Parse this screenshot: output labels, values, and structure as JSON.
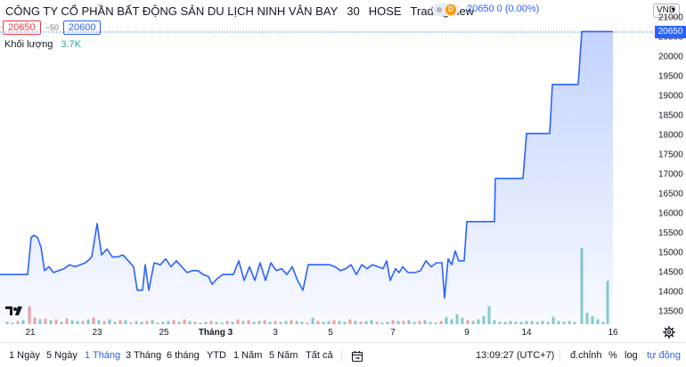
{
  "header": {
    "symbol_name": "CÔNG TY CỔ PHẦN BẤT ĐỘNG SẢN DU LỊCH NINH VÂN BAY",
    "interval": "30",
    "exchange": "HOSE",
    "provider": "TradingView",
    "status_badge": "D",
    "last_price": "20650",
    "change": "0 (0.00%)"
  },
  "quote": {
    "bid": "20650",
    "spread": "−50",
    "ask": "20600"
  },
  "volume": {
    "label": "Khối lượng",
    "value": "3.7K"
  },
  "currency": "VND",
  "price_scale": {
    "ticks": [
      "21000",
      "20500",
      "20000",
      "19500",
      "19000",
      "18500",
      "18000",
      "17500",
      "17000",
      "16500",
      "16000",
      "15500",
      "15000",
      "14500",
      "14000",
      "13500"
    ],
    "current_tag": "20650"
  },
  "time_axis": {
    "ticks": [
      "21",
      "23",
      "25",
      "Tháng 3",
      "3",
      "5",
      "7",
      "9",
      "14",
      "16",
      "21"
    ]
  },
  "bottom_bar": {
    "ranges": [
      "1 Ngày",
      "5 Ngày",
      "1 Tháng",
      "3 Tháng",
      "6 tháng",
      "YTD",
      "1 Năm",
      "5 Năm",
      "Tất cả"
    ],
    "active_range": "1 Tháng",
    "time": "13:09:27 (UTC+7)",
    "adjust": "đ.chỉnh",
    "percent": "%",
    "log": "log",
    "auto": "tự động"
  },
  "colors": {
    "line": "#2962ff",
    "area_top": "rgba(41,98,255,0.28)",
    "up_volume": "#26a69a",
    "down_volume": "#ef5350",
    "accent": "#2962ff"
  },
  "chart_data": {
    "type": "area",
    "ylim": [
      13200,
      21150
    ],
    "price_points": [
      [
        0,
        14450
      ],
      [
        16,
        14450
      ],
      [
        31,
        14450
      ],
      [
        35,
        15400
      ],
      [
        38,
        15450
      ],
      [
        42,
        15400
      ],
      [
        46,
        15150
      ],
      [
        50,
        14550
      ],
      [
        55,
        14650
      ],
      [
        60,
        14500
      ],
      [
        66,
        14550
      ],
      [
        72,
        14600
      ],
      [
        78,
        14700
      ],
      [
        84,
        14650
      ],
      [
        90,
        14700
      ],
      [
        96,
        14750
      ],
      [
        103,
        14900
      ],
      [
        109,
        15750
      ],
      [
        114,
        14950
      ],
      [
        120,
        15100
      ],
      [
        126,
        14900
      ],
      [
        132,
        14900
      ],
      [
        138,
        14950
      ],
      [
        144,
        14800
      ],
      [
        150,
        14650
      ],
      [
        154,
        14050
      ],
      [
        160,
        14050
      ],
      [
        163,
        14700
      ],
      [
        167,
        14050
      ],
      [
        173,
        14750
      ],
      [
        180,
        14700
      ],
      [
        186,
        14850
      ],
      [
        192,
        14650
      ],
      [
        198,
        14800
      ],
      [
        204,
        14650
      ],
      [
        210,
        14500
      ],
      [
        216,
        14550
      ],
      [
        222,
        14550
      ],
      [
        228,
        14450
      ],
      [
        234,
        14400
      ],
      [
        238,
        14200
      ],
      [
        244,
        14350
      ],
      [
        250,
        14450
      ],
      [
        256,
        14450
      ],
      [
        262,
        14450
      ],
      [
        268,
        14800
      ],
      [
        274,
        14300
      ],
      [
        280,
        14650
      ],
      [
        286,
        14300
      ],
      [
        292,
        14750
      ],
      [
        298,
        14300
      ],
      [
        304,
        14750
      ],
      [
        310,
        14550
      ],
      [
        316,
        14600
      ],
      [
        322,
        14450
      ],
      [
        328,
        14650
      ],
      [
        334,
        14300
      ],
      [
        340,
        14050
      ],
      [
        346,
        14700
      ],
      [
        352,
        14700
      ],
      [
        358,
        14700
      ],
      [
        364,
        14700
      ],
      [
        370,
        14700
      ],
      [
        376,
        14650
      ],
      [
        382,
        14550
      ],
      [
        388,
        14600
      ],
      [
        394,
        14700
      ],
      [
        400,
        14450
      ],
      [
        406,
        14700
      ],
      [
        412,
        14600
      ],
      [
        418,
        14700
      ],
      [
        424,
        14650
      ],
      [
        430,
        14600
      ],
      [
        434,
        14800
      ],
      [
        438,
        14300
      ],
      [
        444,
        14600
      ],
      [
        448,
        14500
      ],
      [
        452,
        14650
      ],
      [
        458,
        14500
      ],
      [
        466,
        14500
      ],
      [
        472,
        14550
      ],
      [
        478,
        14800
      ],
      [
        484,
        14650
      ],
      [
        490,
        14750
      ],
      [
        496,
        14750
      ],
      [
        499,
        13850
      ],
      [
        503,
        14850
      ],
      [
        507,
        14700
      ],
      [
        511,
        15050
      ],
      [
        515,
        14800
      ],
      [
        521,
        14800
      ],
      [
        524,
        15800
      ],
      [
        555,
        15800
      ],
      [
        556,
        16900
      ],
      [
        587,
        16900
      ],
      [
        591,
        18050
      ],
      [
        617,
        18050
      ],
      [
        620,
        19300
      ],
      [
        649,
        19300
      ],
      [
        653,
        20650
      ],
      [
        688,
        20650
      ]
    ],
    "volume_x": [
      8,
      14,
      20,
      26,
      33,
      39,
      45,
      51,
      57,
      63,
      69,
      75,
      81,
      87,
      93,
      99,
      105,
      111,
      117,
      123,
      129,
      135,
      141,
      147,
      153,
      159,
      165,
      171,
      177,
      183,
      189,
      195,
      201,
      207,
      213,
      219,
      225,
      231,
      237,
      243,
      249,
      255,
      261,
      267,
      273,
      279,
      285,
      291,
      297,
      303,
      309,
      315,
      321,
      327,
      333,
      339,
      345,
      351,
      357,
      363,
      369,
      375,
      381,
      387,
      393,
      399,
      405,
      411,
      417,
      423,
      429,
      435,
      441,
      447,
      453,
      459,
      465,
      471,
      477,
      483,
      489,
      495,
      501,
      507,
      513,
      519,
      525,
      531,
      537,
      543,
      549,
      555,
      561,
      567,
      573,
      579,
      585,
      591,
      597,
      603,
      609,
      615,
      621,
      627,
      633,
      639,
      645,
      653,
      659,
      665,
      671,
      677,
      682
    ],
    "volume_level": [
      0.03,
      0.02,
      0.04,
      0.05,
      0.22,
      0.08,
      0.06,
      0.07,
      0.05,
      0.06,
      0.03,
      0.07,
      0.05,
      0.04,
      0.04,
      0.06,
      0.08,
      0.05,
      0.04,
      0.06,
      0.03,
      0.05,
      0.05,
      0.02,
      0.04,
      0.03,
      0.04,
      0.05,
      0.02,
      0.03,
      0.04,
      0.05,
      0.03,
      0.06,
      0.04,
      0.03,
      0.02,
      0.03,
      0.04,
      0.03,
      0.02,
      0.04,
      0.03,
      0.06,
      0.04,
      0.05,
      0.03,
      0.04,
      0.05,
      0.03,
      0.04,
      0.03,
      0.04,
      0.05,
      0.04,
      0.03,
      0.02,
      0.08,
      0.04,
      0.03,
      0.04,
      0.05,
      0.04,
      0.03,
      0.06,
      0.04,
      0.03,
      0.04,
      0.05,
      0.03,
      0.02,
      0.03,
      0.05,
      0.04,
      0.04,
      0.05,
      0.03,
      0.04,
      0.05,
      0.03,
      0.02,
      0.04,
      0.09,
      0.06,
      0.12,
      0.08,
      0.05,
      0.04,
      0.06,
      0.1,
      0.22,
      0.05,
      0.03,
      0.03,
      0.04,
      0.03,
      0.03,
      0.04,
      0.04,
      0.03,
      0.04,
      0.03,
      0.09,
      0.04,
      0.03,
      0.04,
      0.03,
      0.93,
      0.14,
      0.1,
      0.06,
      0.03,
      0.53
    ],
    "volume_up": [
      1,
      1,
      0,
      1,
      0,
      0,
      1,
      0,
      1,
      0,
      1,
      0,
      1,
      1,
      0,
      1,
      0,
      1,
      0,
      1,
      1,
      0,
      1,
      0,
      1,
      1,
      0,
      1,
      0,
      1,
      1,
      0,
      1,
      0,
      1,
      0,
      1,
      1,
      0,
      1,
      1,
      0,
      1,
      0,
      1,
      0,
      1,
      1,
      0,
      1,
      0,
      1,
      1,
      0,
      1,
      1,
      0,
      1,
      0,
      1,
      1,
      0,
      1,
      1,
      0,
      1,
      0,
      1,
      1,
      0,
      1,
      1,
      0,
      1,
      0,
      1,
      1,
      0,
      1,
      1,
      1,
      0,
      1,
      1,
      1,
      1,
      0,
      1,
      1,
      1,
      1,
      1,
      1,
      1,
      1,
      1,
      1,
      1,
      1,
      1,
      1,
      1,
      1,
      1,
      1,
      1,
      1,
      1,
      1,
      1,
      1,
      1,
      1
    ]
  }
}
